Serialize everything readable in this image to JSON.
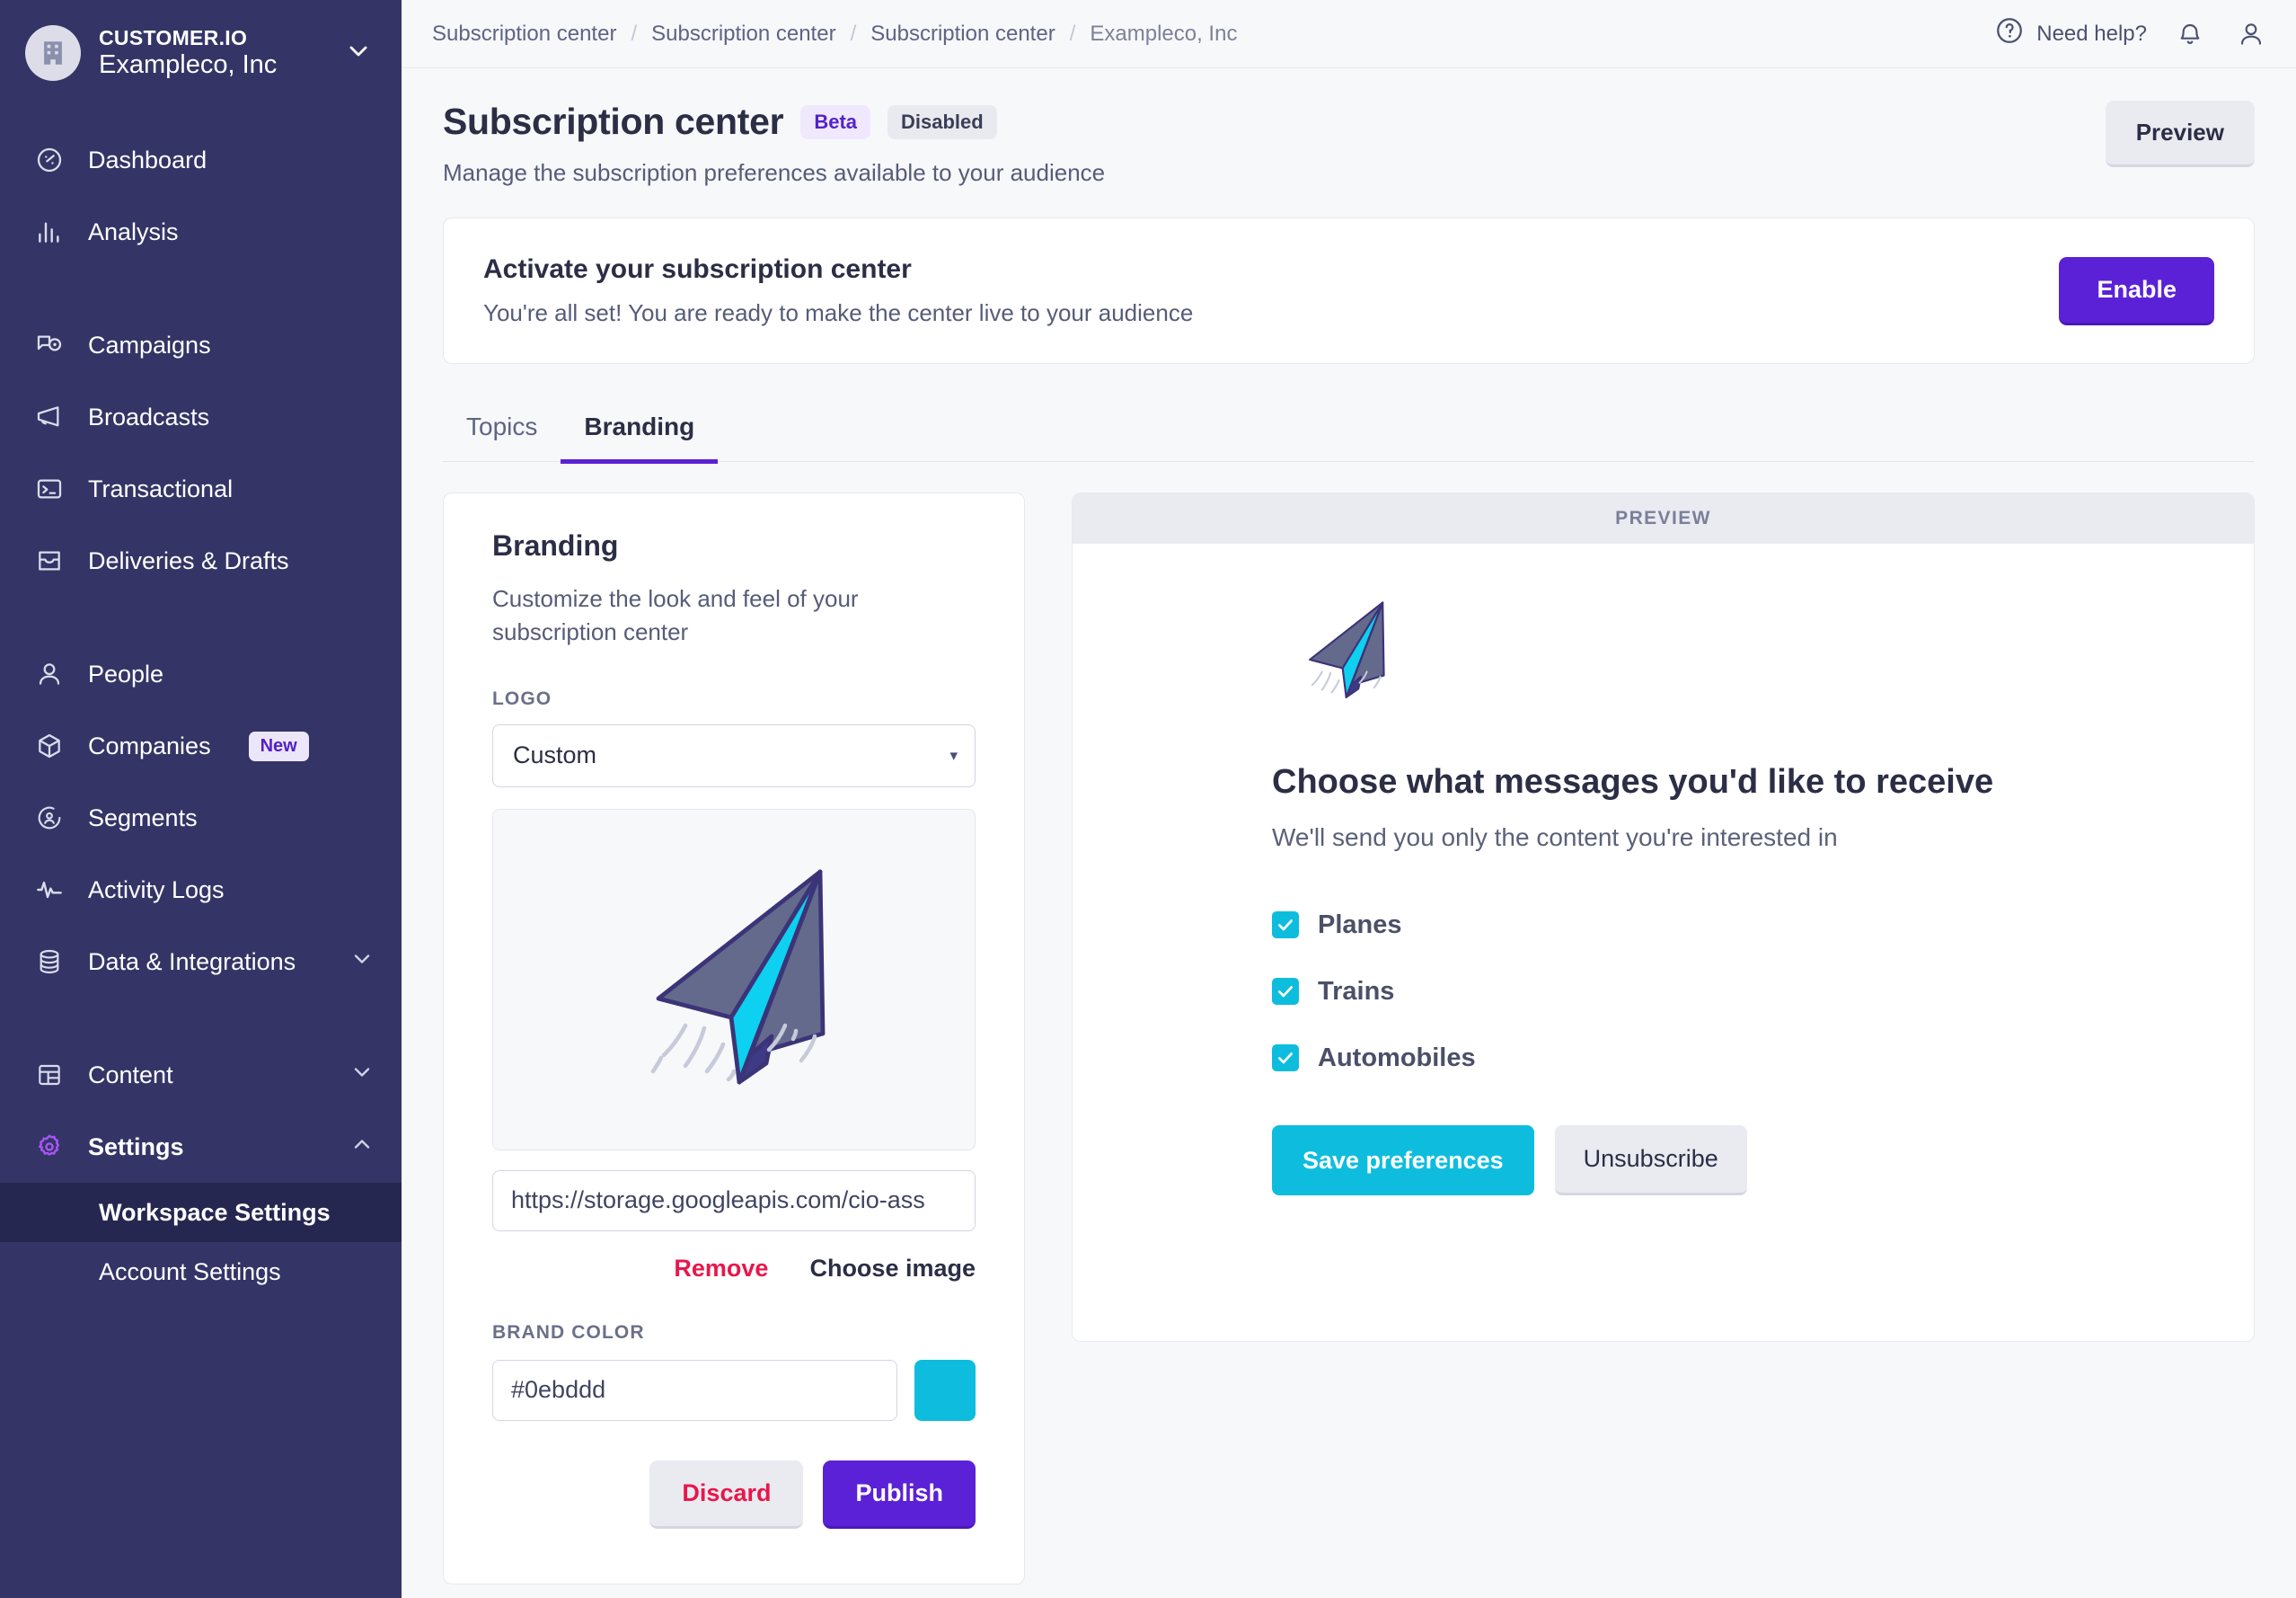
{
  "sidebar": {
    "workspace": {
      "eyebrow": "CUSTOMER.IO",
      "name": "Exampleco, Inc",
      "avatar_icon": "building-icon",
      "caret_icon": "chevron-down-icon"
    },
    "groups": [
      {
        "items": [
          {
            "label": "Dashboard",
            "icon": "gauge-icon"
          },
          {
            "label": "Analysis",
            "icon": "bar-chart-icon"
          }
        ]
      },
      {
        "items": [
          {
            "label": "Campaigns",
            "icon": "campaign-icon"
          },
          {
            "label": "Broadcasts",
            "icon": "megaphone-icon"
          },
          {
            "label": "Transactional",
            "icon": "terminal-icon"
          },
          {
            "label": "Deliveries & Drafts",
            "icon": "inbox-icon"
          }
        ]
      },
      {
        "items": [
          {
            "label": "People",
            "icon": "user-icon"
          },
          {
            "label": "Companies",
            "icon": "cube-icon",
            "badge": "New"
          },
          {
            "label": "Segments",
            "icon": "segment-icon"
          },
          {
            "label": "Activity Logs",
            "icon": "pulse-icon"
          },
          {
            "label": "Data & Integrations",
            "icon": "database-icon",
            "chevron": "chevron-down-icon"
          }
        ]
      },
      {
        "items": [
          {
            "label": "Content",
            "icon": "layout-icon",
            "chevron": "chevron-down-icon"
          },
          {
            "label": "Settings",
            "icon": "gear-icon",
            "chevron": "chevron-up-icon",
            "active": true
          }
        ]
      }
    ],
    "subitems": [
      {
        "label": "Workspace Settings",
        "selected": true
      },
      {
        "label": "Account Settings",
        "selected": false
      }
    ]
  },
  "topbar": {
    "breadcrumbs": [
      "Subscription center",
      "Subscription center",
      "Subscription center",
      "Exampleco, Inc"
    ],
    "separator": "/",
    "help_label": "Need help?",
    "help_icon": "question-circle-icon",
    "bell_icon": "bell-icon",
    "account_icon": "user-avatar-icon"
  },
  "page": {
    "title": "Subscription center",
    "badge_beta": "Beta",
    "badge_status": "Disabled",
    "subtitle": "Manage the subscription preferences available to your audience",
    "preview_button": "Preview"
  },
  "activate": {
    "title": "Activate your subscription center",
    "subtitle": "You're all set! You are ready to make the center live to your audience",
    "enable_button": "Enable"
  },
  "tabs": [
    {
      "label": "Topics",
      "active": false
    },
    {
      "label": "Branding",
      "active": true
    }
  ],
  "branding": {
    "title": "Branding",
    "subtitle": "Customize the look and feel of your subscription center",
    "logo_label": "LOGO",
    "logo_select_value": "Custom",
    "logo_select_options": [
      "Custom"
    ],
    "logo_image_icon": "paper-plane-logo",
    "url_value": "https://storage.googleapis.com/cio-ass",
    "remove_link": "Remove",
    "choose_image_link": "Choose image",
    "brand_color_label": "BRAND COLOR",
    "brand_color_value": "#0ebddd",
    "discard_button": "Discard",
    "publish_button": "Publish"
  },
  "preview": {
    "bar_label": "PREVIEW",
    "logo_icon": "paper-plane-logo",
    "heading": "Choose what messages you'd like to receive",
    "subheading": "We'll send you only the content you're interested in",
    "topics": [
      {
        "label": "Planes",
        "checked": true
      },
      {
        "label": "Trains",
        "checked": true
      },
      {
        "label": "Automobiles",
        "checked": true
      }
    ],
    "save_button": "Save preferences",
    "unsubscribe_button": "Unsubscribe"
  },
  "colors": {
    "brand": "#0ebddd",
    "accent_purple": "#5b21d6",
    "sidebar_bg": "#343566",
    "danger": "#e8174b"
  }
}
